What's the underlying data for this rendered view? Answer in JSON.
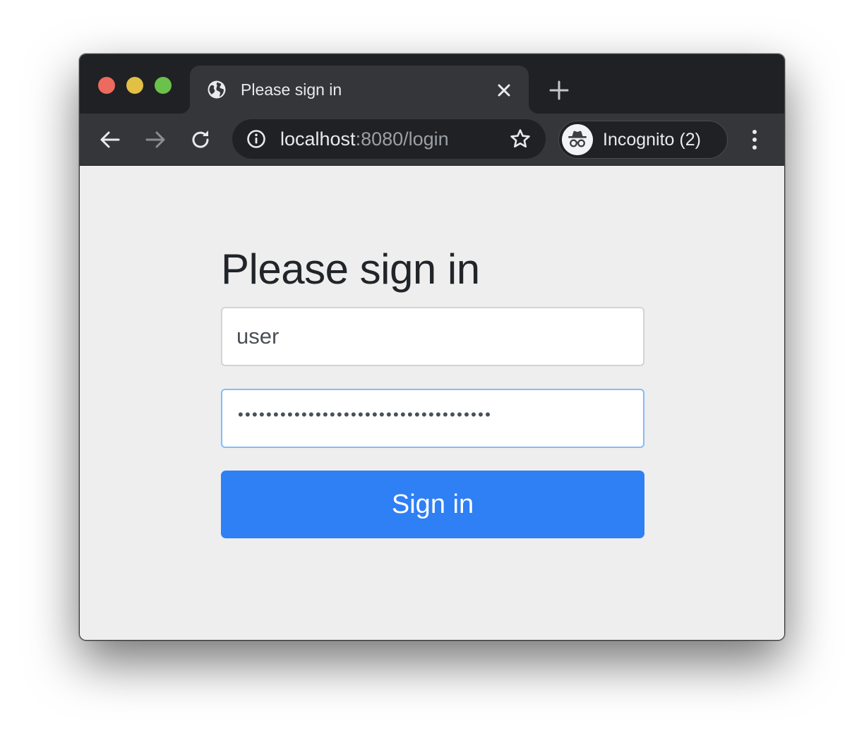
{
  "browser": {
    "tab": {
      "title": "Please sign in",
      "favicon": "globe-icon"
    },
    "omnibox": {
      "host": "localhost",
      "path": ":8080/login"
    },
    "profile": {
      "label": "Incognito (2)",
      "icon": "incognito-icon"
    }
  },
  "login": {
    "heading": "Please sign in",
    "username": {
      "value": "user"
    },
    "password": {
      "masked": "••••••••••••••••••••••••••••••••••••"
    },
    "submit_label": "Sign in"
  },
  "colors": {
    "titlebar": "#202124",
    "toolbar": "#35363a",
    "page_bg": "#eeeeee",
    "primary": "#2f7ff5",
    "focus_border": "#80bdff"
  }
}
